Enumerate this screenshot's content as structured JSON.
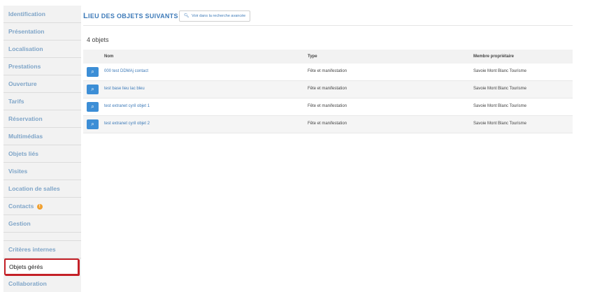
{
  "sidebar": {
    "items": [
      {
        "label": "Identification"
      },
      {
        "label": "Présentation"
      },
      {
        "label": "Localisation"
      },
      {
        "label": "Prestations"
      },
      {
        "label": "Ouverture"
      },
      {
        "label": "Tarifs"
      },
      {
        "label": "Réservation"
      },
      {
        "label": "Multimédias"
      },
      {
        "label": "Objets liés"
      },
      {
        "label": "Visites"
      },
      {
        "label": "Location de salles"
      },
      {
        "label": "Contacts"
      },
      {
        "label": "Gestion"
      }
    ],
    "items2": [
      {
        "label": "Critères internes"
      },
      {
        "label": "Objets gérés"
      },
      {
        "label": "Collaboration"
      }
    ],
    "warning_badge": "!"
  },
  "main": {
    "title": "Lieu des objets suivants",
    "advanced_search_label": "Voir dans la recherche avancée",
    "count_label": "4 objets",
    "columns": {
      "name": "Nom",
      "type": "Type",
      "owner": "Membre propriétaire"
    },
    "rows": [
      {
        "name": "000 test DDMAj contact",
        "type": "Fête et manifestation",
        "owner": "Savoie Mont Blanc Tourisme"
      },
      {
        "name": "test base lieu lac bleu",
        "type": "Fête et manifestation",
        "owner": "Savoie Mont Blanc Tourisme"
      },
      {
        "name": "test extranet cyril objet 1",
        "type": "Fête et manifestation",
        "owner": "Savoie Mont Blanc Tourisme"
      },
      {
        "name": "test extranet cyril objet 2",
        "type": "Fête et manifestation",
        "owner": "Savoie Mont Blanc Tourisme"
      }
    ]
  },
  "colors": {
    "link": "#3d7ab8",
    "button": "#3c8ed6",
    "highlight": "#c42027",
    "sidebar_text": "#7fa5c8"
  },
  "icons": {
    "search": "magnifier-icon",
    "warning": "warning-icon"
  }
}
